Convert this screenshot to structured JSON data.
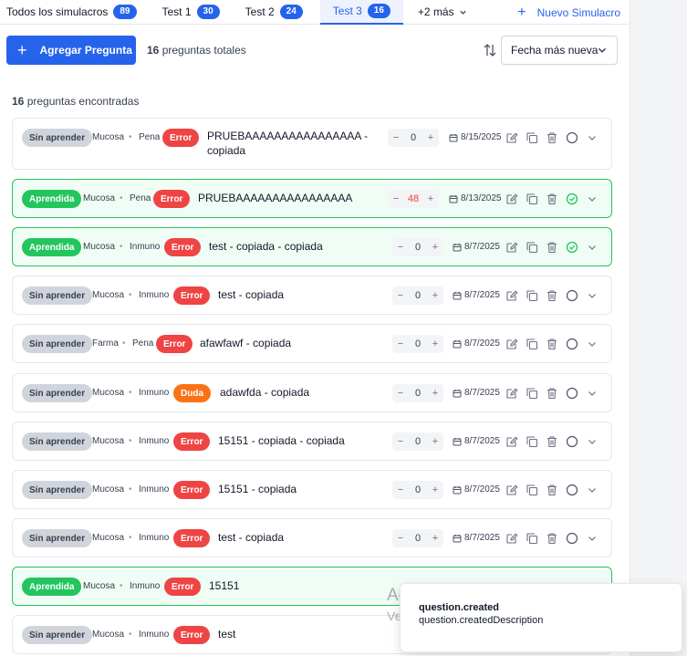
{
  "tabs": [
    {
      "label": "Todos los simulacros",
      "count": "89"
    },
    {
      "label": "Test 1",
      "count": "30"
    },
    {
      "label": "Test 2",
      "count": "24"
    },
    {
      "label": "Test 3",
      "count": "16"
    }
  ],
  "more_tabs": "+2 más",
  "new_simulation": "Nuevo Simulacro",
  "toolbar": {
    "add_question": "Agregar Pregunta",
    "total_count": "16",
    "total_label": " preguntas totales",
    "sort_value": "Fecha más nueva"
  },
  "found": {
    "count": "16",
    "label": " preguntas encontradas"
  },
  "questions": [
    {
      "status": "Sin aprender",
      "subject": "Mucosa",
      "topic": "Pena",
      "tag": "Error",
      "title": "PRUEBAAAAAAAAAAAAAAAA - copiada",
      "value": "0",
      "date": "8/15/2025"
    },
    {
      "status": "Aprendida",
      "subject": "Mucosa",
      "topic": "Pena",
      "tag": "Error",
      "title": "PRUEBAAAAAAAAAAAAAAAA",
      "value": "48",
      "date": "8/13/2025"
    },
    {
      "status": "Aprendida",
      "subject": "Mucosa",
      "topic": "Inmuno",
      "tag": "Error",
      "title": "test - copiada - copiada",
      "value": "0",
      "date": "8/7/2025"
    },
    {
      "status": "Sin aprender",
      "subject": "Mucosa",
      "topic": "Inmuno",
      "tag": "Error",
      "title": "test - copiada",
      "value": "0",
      "date": "8/7/2025"
    },
    {
      "status": "Sin aprender",
      "subject": "Farma",
      "topic": "Pena",
      "tag": "Error",
      "title": "afawfawf - copiada",
      "value": "0",
      "date": "8/7/2025"
    },
    {
      "status": "Sin aprender",
      "subject": "Mucosa",
      "topic": "Inmuno",
      "tag": "Duda",
      "title": "adawfda - copiada",
      "value": "0",
      "date": "8/7/2025"
    },
    {
      "status": "Sin aprender",
      "subject": "Mucosa",
      "topic": "Inmuno",
      "tag": "Error",
      "title": "15151 - copiada - copiada",
      "value": "0",
      "date": "8/7/2025"
    },
    {
      "status": "Sin aprender",
      "subject": "Mucosa",
      "topic": "Inmuno",
      "tag": "Error",
      "title": "15151 - copiada",
      "value": "0",
      "date": "8/7/2025"
    },
    {
      "status": "Sin aprender",
      "subject": "Mucosa",
      "topic": "Inmuno",
      "tag": "Error",
      "title": "test - copiada",
      "value": "0",
      "date": "8/7/2025"
    },
    {
      "status": "Aprendida",
      "subject": "Mucosa",
      "topic": "Inmuno",
      "tag": "Error",
      "title": "15151"
    },
    {
      "status": "Sin aprender",
      "subject": "Mucosa",
      "topic": "Inmuno",
      "tag": "Error",
      "title": "test"
    }
  ],
  "toast": {
    "title": "question.created",
    "description": "question.createdDescription"
  },
  "watermark": {
    "line1": "Activar Windows",
    "line2": "Ve a Configuración para activar Windows."
  },
  "colors": {
    "primary": "#2563eb",
    "learned": "#22c55e",
    "error": "#ef4444",
    "duda": "#f97316"
  }
}
